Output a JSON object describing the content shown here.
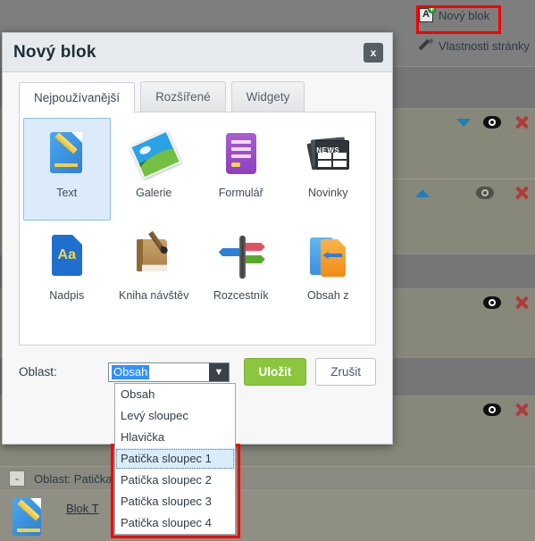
{
  "toolbar": {
    "new_block": {
      "label": "Nový blok",
      "icon": "a-block-add-icon",
      "badge": "+"
    },
    "page_properties": {
      "label": "Vlastnosti stránky",
      "icon": "pencil-icon"
    }
  },
  "dialog": {
    "title": "Nový blok",
    "close_label": "x",
    "tabs": [
      {
        "label": "Nejpoužívanější",
        "active": true
      },
      {
        "label": "Rozšířené",
        "active": false
      },
      {
        "label": "Widgety",
        "active": false
      }
    ],
    "blocks": [
      {
        "label": "Text",
        "icon": "text-document-icon",
        "selected": true
      },
      {
        "label": "Galerie",
        "icon": "gallery-photo-icon",
        "selected": false
      },
      {
        "label": "Formulář",
        "icon": "form-icon",
        "selected": false
      },
      {
        "label": "Novinky",
        "icon": "news-icon",
        "selected": false
      },
      {
        "label": "Nadpis",
        "icon": "heading-aa-icon",
        "selected": false
      },
      {
        "label": "Kniha návštěv",
        "icon": "guestbook-icon",
        "selected": false
      },
      {
        "label": "Rozcestník",
        "icon": "signpost-icon",
        "selected": false
      },
      {
        "label": "Obsah z",
        "icon": "content-from-icon",
        "selected": false
      }
    ],
    "area": {
      "label": "Oblast:",
      "selected_value": "Obsah",
      "dropdown_arrow": "▼",
      "options": [
        {
          "label": "Obsah",
          "highlighted": false
        },
        {
          "label": "Levý sloupec",
          "highlighted": false
        },
        {
          "label": "Hlavička",
          "highlighted": false
        },
        {
          "label": "Patička sloupec 1",
          "highlighted": true
        },
        {
          "label": "Patička sloupec 2",
          "highlighted": false
        },
        {
          "label": "Patička sloupec 3",
          "highlighted": false
        },
        {
          "label": "Patička sloupec 4",
          "highlighted": false
        }
      ]
    },
    "buttons": {
      "save": "Uložit",
      "cancel": "Zrušit"
    }
  },
  "background": {
    "rows": [
      {
        "icons": [
          "chevron-down-icon",
          "eye-icon",
          "delete-x-icon"
        ]
      },
      {
        "icons": [
          "chevron-up-icon",
          "eye-dim-icon",
          "delete-x-icon"
        ]
      },
      {
        "icons": [
          "eye-icon",
          "delete-x-icon"
        ]
      },
      {
        "icons": [
          "eye-icon",
          "delete-x-icon"
        ]
      }
    ],
    "bottom_strip": {
      "collapse_label": "-",
      "title": "Oblast: Patička",
      "block_link": "Blok T",
      "block_icon": "text-document-icon"
    }
  },
  "colors": {
    "accent_green": "#8cc63e",
    "annotation_red": "#f40000",
    "selection_blue": "#3390ff",
    "tile_selected_bg": "#dcebfa",
    "delete_red": "#b03a3a",
    "chevron_blue": "#1f7fb5"
  }
}
